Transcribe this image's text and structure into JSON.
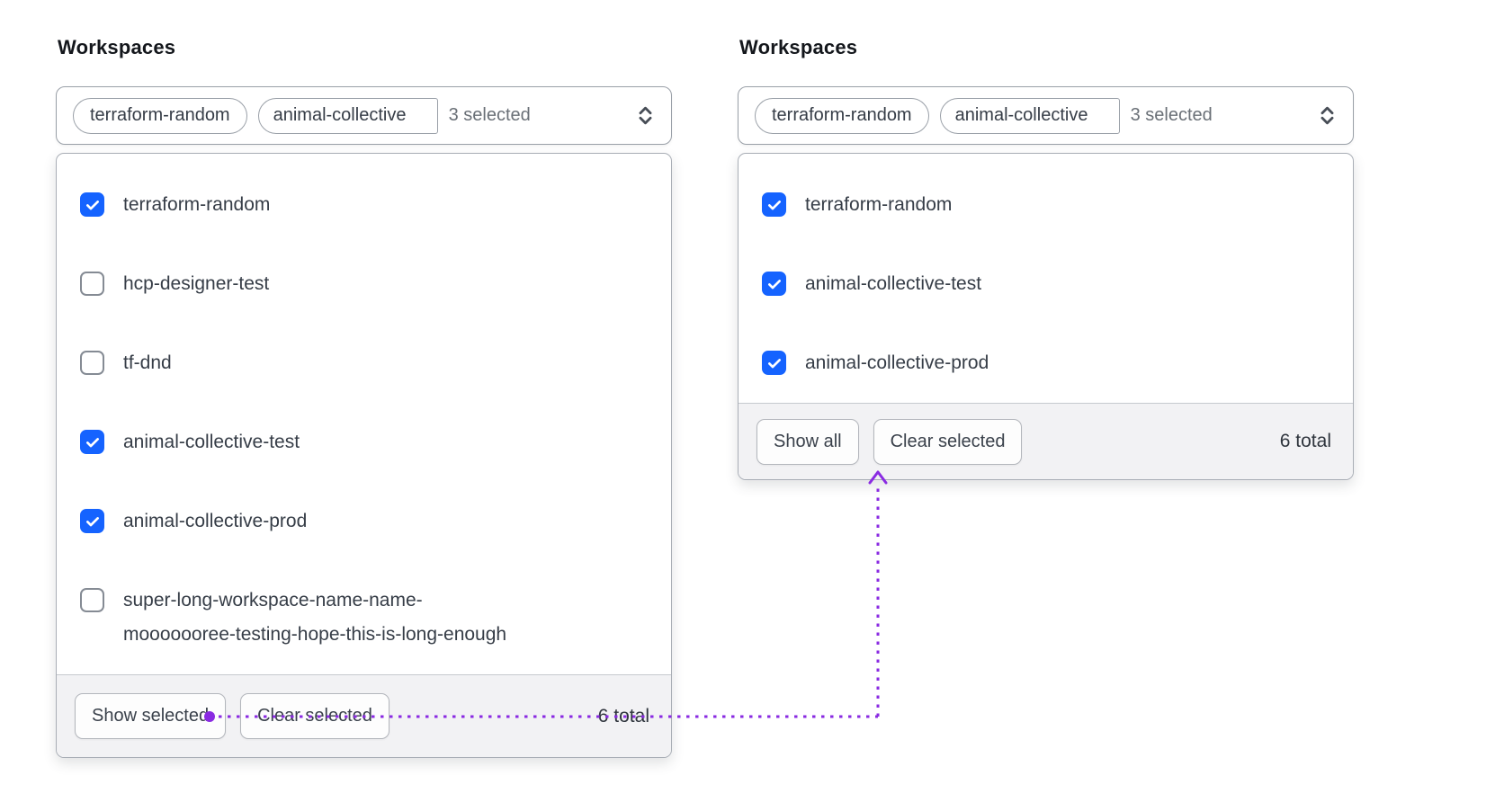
{
  "colors": {
    "accent": "#1563ff",
    "annotation": "#8a2be2"
  },
  "left_panel": {
    "label": "Workspaces",
    "trigger": {
      "pills": [
        "terraform-random",
        "animal-collective"
      ],
      "count_label": "3 selected"
    },
    "items": [
      {
        "label": "terraform-random",
        "checked": true
      },
      {
        "label": "hcp-designer-test",
        "checked": false
      },
      {
        "label": "tf-dnd",
        "checked": false
      },
      {
        "label": "animal-collective-test",
        "checked": true
      },
      {
        "label": "animal-collective-prod",
        "checked": true
      },
      {
        "label": "super-long-workspace-name-name-mooooooree-testing-hope-this-is-long-enough",
        "label_line1": "super-long-workspace-name-name-",
        "label_line2": "mooooooree-testing-hope-this-is-long-enough",
        "checked": false
      }
    ],
    "footer": {
      "toggle_label": "Show selected",
      "clear_label": "Clear selected",
      "total_label": "6 total"
    }
  },
  "right_panel": {
    "label": "Workspaces",
    "trigger": {
      "pills": [
        "terraform-random",
        "animal-collective"
      ],
      "count_label": "3 selected"
    },
    "items": [
      {
        "label": "terraform-random",
        "checked": true
      },
      {
        "label": "animal-collective-test",
        "checked": true
      },
      {
        "label": "animal-collective-prod",
        "checked": true
      }
    ],
    "footer": {
      "toggle_label": "Show all",
      "clear_label": "Clear selected",
      "total_label": "6 total"
    }
  }
}
